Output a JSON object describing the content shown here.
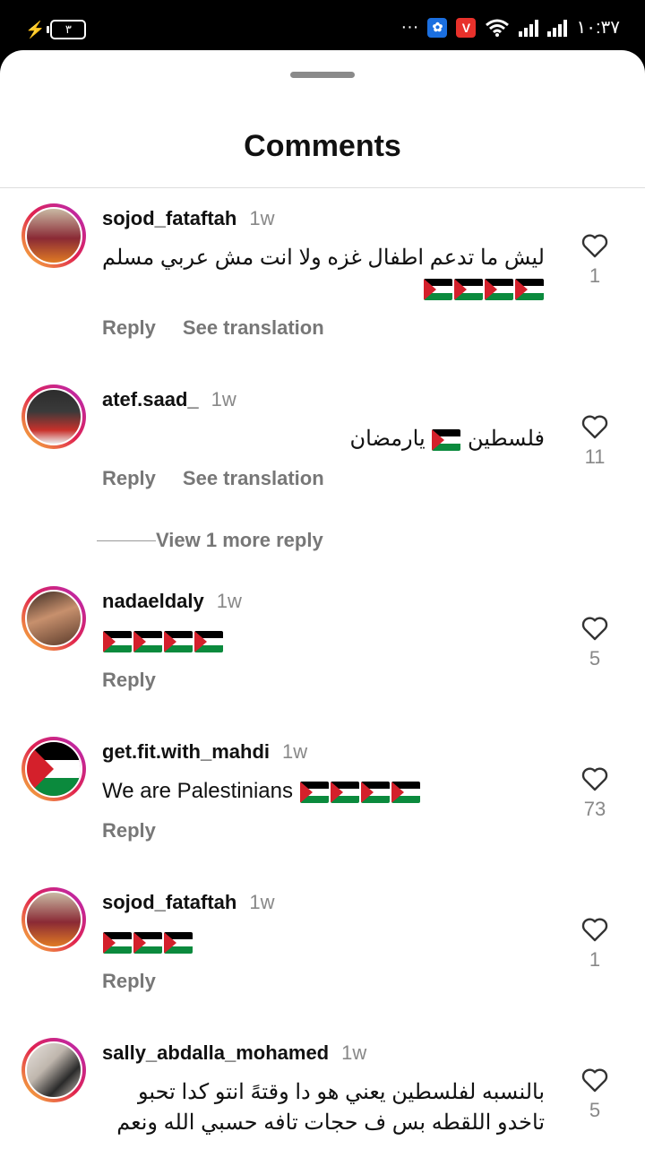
{
  "status_bar": {
    "battery": "٣",
    "time": "١٠:٣٧",
    "dots": "···"
  },
  "sheet": {
    "title": "Comments"
  },
  "comments": [
    {
      "username": "sojod_fataftah",
      "time": "1w",
      "text": "ليش ما تدعم اطفال غزه ولا انت مش عربي مسلم",
      "flags": 4,
      "reply": "Reply",
      "translate": "See translation",
      "likes": "1"
    },
    {
      "username": "atef.saad_",
      "time": "1w",
      "text_before": "فلسطين",
      "text_after": "يارمضان",
      "flags": 1,
      "reply": "Reply",
      "translate": "See translation",
      "likes": "11"
    },
    {
      "username": "nadaeldaly",
      "time": "1w",
      "text": "",
      "flags": 4,
      "reply": "Reply",
      "likes": "5"
    },
    {
      "username": "get.fit.with_mahdi",
      "time": "1w",
      "text": "We are Palestinians",
      "flags": 4,
      "reply": "Reply",
      "likes": "73"
    },
    {
      "username": "sojod_fataftah",
      "time": "1w",
      "text": "",
      "flags": 3,
      "reply": "Reply",
      "likes": "1"
    },
    {
      "username": "sally_abdalla_mohamed",
      "time": "1w",
      "text": "بالنسبه لفلسطين يعني هو دا وقتهً انتو كدا تحبو تاخدو اللقطه بس ف حجات تافه حسبي الله ونعم",
      "likes": "5"
    }
  ],
  "view_more": "View 1 more reply",
  "colors": {
    "accent_gradient": [
      "#f8c33a",
      "#e0224f",
      "#b52ac0"
    ],
    "flag_red": "#d4202b",
    "flag_green": "#0b8a3d"
  }
}
